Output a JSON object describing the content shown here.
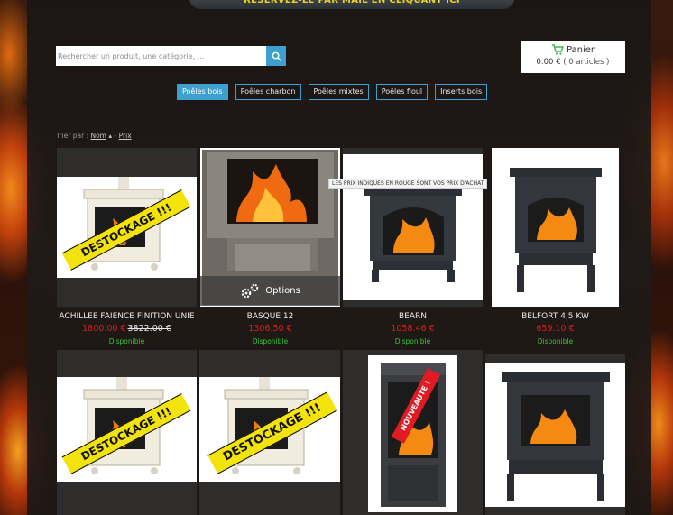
{
  "banner": {
    "text": "RÉSERVEZ-LE PAR MAIL EN CLIQUANT ICI"
  },
  "search": {
    "placeholder": "Rechercher un produit, une catégorie, ..."
  },
  "cart": {
    "title": "Panier",
    "total": "0.00 €",
    "count": "( 0 articles )"
  },
  "categories": [
    {
      "label": "Poêles bois",
      "active": true
    },
    {
      "label": "Poêles charbon",
      "active": false
    },
    {
      "label": "Poêles mixtes",
      "active": false
    },
    {
      "label": "Poêles fioul",
      "active": false
    },
    {
      "label": "Inserts bois",
      "active": false
    }
  ],
  "sort": {
    "prefix": "Trier par :",
    "name": "Nom",
    "sep": "-",
    "price": "Prix"
  },
  "tooltip": "LES PRIX INDIQUES EN ROUGE SONT VOS PRIX D'ACHAT",
  "options_label": "Options",
  "products": [
    {
      "name": "ACHILLEE FAIENCE FINITION UNIE",
      "price": "1800.00 €",
      "old_price": "3822.00 €",
      "availability": "Disponible",
      "ribbon": "DESTOCKAGE !!!"
    },
    {
      "name": "BASQUE 12",
      "price": "1306.50 €",
      "old_price": "",
      "availability": "Disponible",
      "ribbon": ""
    },
    {
      "name": "BEARN",
      "price": "1058.46 €",
      "old_price": "",
      "availability": "Disponible",
      "ribbon": ""
    },
    {
      "name": "BELFORT 4,5 KW",
      "price": "659.10 €",
      "old_price": "",
      "availability": "Disponible",
      "ribbon": ""
    },
    {
      "name": "",
      "price": "",
      "old_price": "",
      "availability": "",
      "ribbon": "DESTOCKAGE !!!"
    },
    {
      "name": "",
      "price": "",
      "old_price": "",
      "availability": "",
      "ribbon": "DESTOCKAGE !!!"
    },
    {
      "name": "",
      "price": "",
      "old_price": "",
      "availability": "",
      "ribbon": "NOUVEAUTE !"
    },
    {
      "name": "",
      "price": "",
      "old_price": "",
      "availability": "",
      "ribbon": ""
    }
  ],
  "colors": {
    "accent": "#3ea0cf",
    "price_red": "#d81d1d",
    "available_green": "#39c23b",
    "ribbon_yellow": "#f2e30c",
    "ribbon_red": "#e01b24"
  }
}
